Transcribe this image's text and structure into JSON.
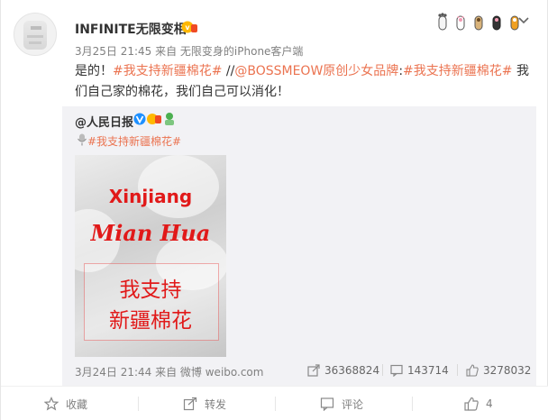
{
  "post": {
    "author": "INFINITE无限变相",
    "meta": "3月25日 21:45 来自 无限变身的iPhone客户端",
    "text": {
      "prefix": "是的！",
      "topic1": "#我支持新疆棉花#",
      "middle": " //",
      "mention": "@BOSSMEOW原创少女品牌",
      "colon": ":",
      "topic2": "#我支持新疆棉花#",
      "suffix": " 我们自己家的棉花，我们自己可以消化！"
    },
    "emote_icons": [
      "paw-icon",
      "cat-paw-icon",
      "dog-paw-icon",
      "cat-paw-icon",
      "paw-icon"
    ]
  },
  "repost": {
    "author": "@人民日报",
    "topic": "#我支持新疆棉花#",
    "image": {
      "line1": "Xinjiang",
      "line2": "Mian Hua",
      "cn1": "我支持",
      "cn2": "新疆棉花"
    },
    "meta": "3月24日 21:44 来自 微博 weibo.com",
    "stats": {
      "reposts": "36368824",
      "comments": "143714",
      "likes": "3278032"
    }
  },
  "actions": {
    "favorite": "收藏",
    "forward": "转发",
    "comment": "评论",
    "like": "4"
  },
  "colors": {
    "link": "#eb7350",
    "repost_bg": "#f2f2f5",
    "image_text": "#e11919"
  }
}
